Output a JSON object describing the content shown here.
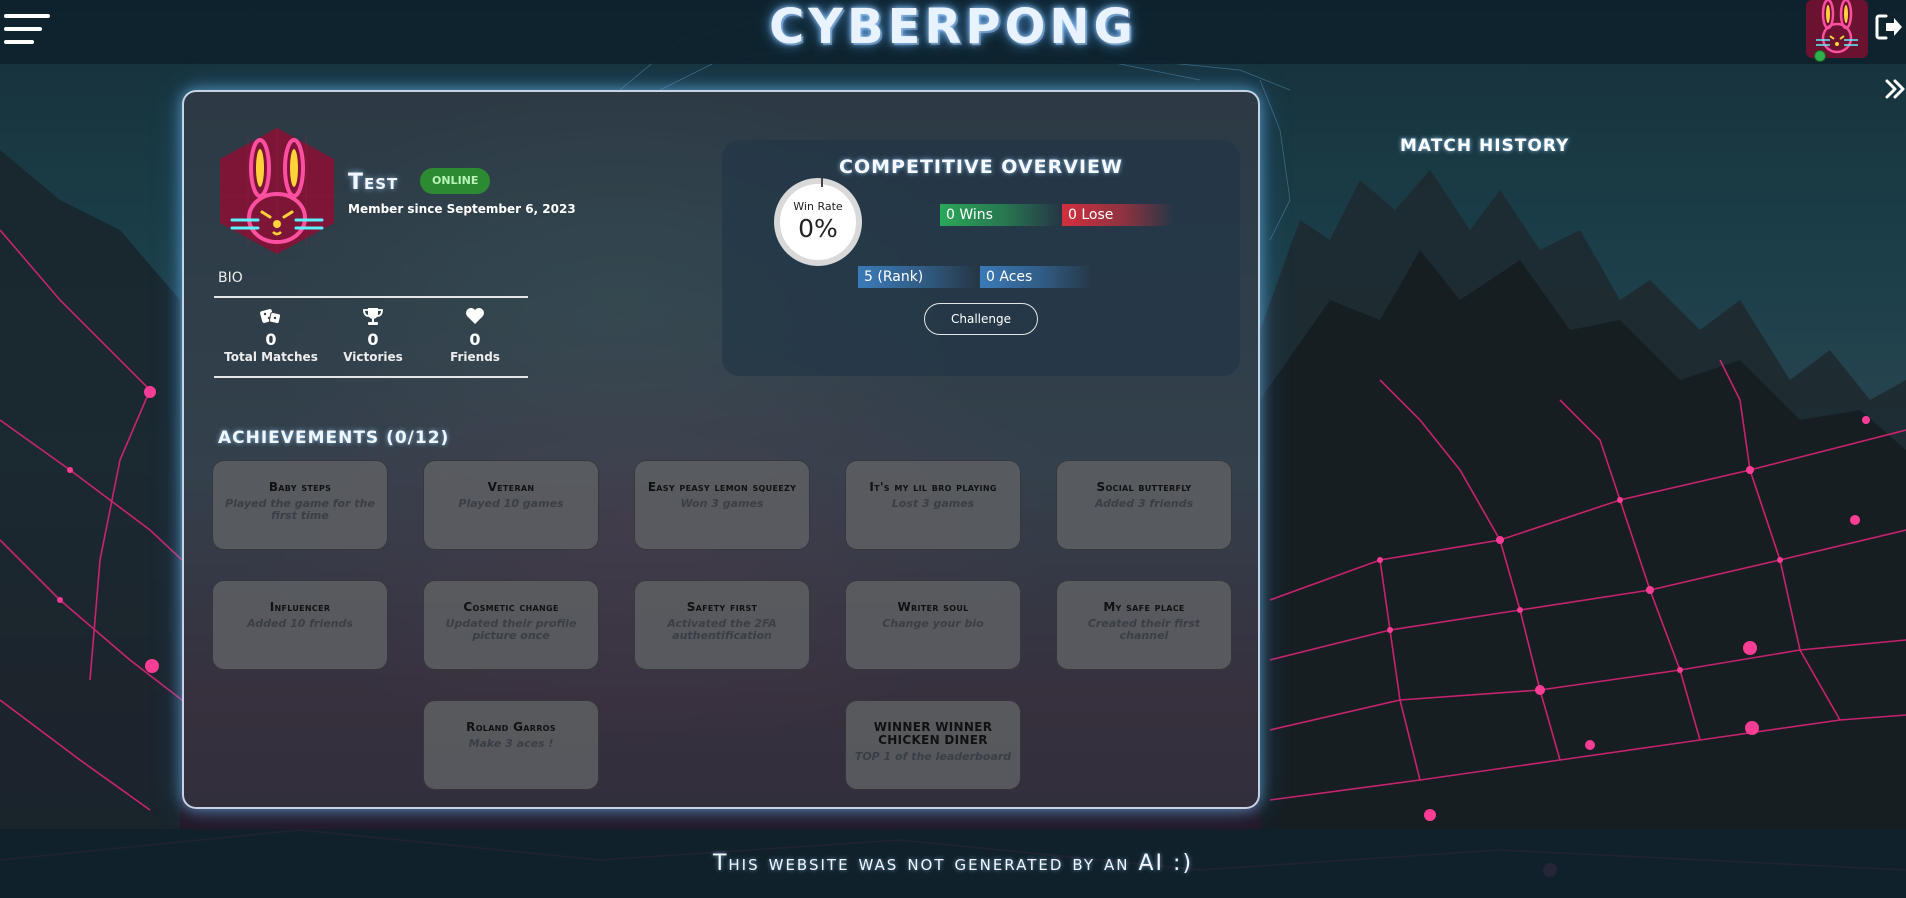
{
  "header": {
    "brand": "CYBERPONG",
    "menu_icon": "hamburger-menu-icon",
    "avatar_icon": "bunny-avatar-icon",
    "logout_icon": "logout-icon"
  },
  "profile": {
    "username": "Test",
    "status": "ONLINE",
    "member_since": "Member since September 6, 2023",
    "bio_label": "BIO",
    "stats": [
      {
        "icon": "dice-icon",
        "value": "0",
        "label": "Total Matches"
      },
      {
        "icon": "trophy-icon",
        "value": "0",
        "label": "Victories"
      },
      {
        "icon": "heart-icon",
        "value": "0",
        "label": "Friends"
      }
    ]
  },
  "overview": {
    "title": "COMPETITIVE OVERVIEW",
    "win_rate_label": "Win Rate",
    "win_rate_value": "0%",
    "wins": "0 Wins",
    "lose": "0 Lose",
    "rank": "5 (Rank)",
    "aces": "0 Aces",
    "challenge_label": "Challenge"
  },
  "achievements": {
    "title": "ACHIEVEMENTS (0/12)",
    "items": [
      {
        "name": "Baby steps",
        "desc": "Played the game for the first time"
      },
      {
        "name": "Veteran",
        "desc": "Played 10 games"
      },
      {
        "name": "Easy peasy lemon squeezy",
        "desc": "Won 3 games"
      },
      {
        "name": "It's my lil bro playing",
        "desc": "Lost 3 games"
      },
      {
        "name": "Social butterfly",
        "desc": "Added 3 friends"
      },
      {
        "name": "Influencer",
        "desc": "Added 10 friends"
      },
      {
        "name": "Cosmetic change",
        "desc": "Updated their profile picture once"
      },
      {
        "name": "Safety first",
        "desc": "Activated the 2FA authentification"
      },
      {
        "name": "Writer soul",
        "desc": "Change your bio"
      },
      {
        "name": "My safe place",
        "desc": "Created their first channel"
      },
      {
        "name": "Roland Garros",
        "desc": "Make 3 aces !"
      },
      {
        "name": "WINNER WINNER CHICKEN DINER",
        "desc": "TOP 1 of the leaderboard"
      }
    ]
  },
  "match_history": {
    "title": "MATCH HISTORY"
  },
  "footer": {
    "text": "This website was not generated by an AI :)"
  },
  "colors": {
    "accent_glow": "#7cc4ff",
    "online": "#2c8a33",
    "wins": "#2aa858",
    "lose": "#d32f3c",
    "rank": "#3b7ab8",
    "neon_pink": "#ff2a8a"
  }
}
